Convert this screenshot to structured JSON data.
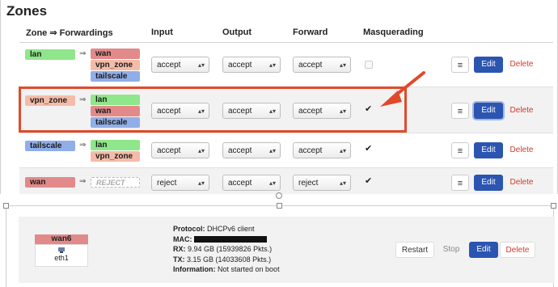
{
  "section_title": "Zones",
  "header": {
    "zone": "Zone ⇒ Forwardings",
    "input": "Input",
    "output": "Output",
    "forward": "Forward",
    "masq": "Masquerading"
  },
  "zones": [
    {
      "name": "lan",
      "targets": [
        "wan",
        "vpn_zone",
        "tailscale"
      ],
      "input": "accept",
      "output": "accept",
      "forward": "accept",
      "masq": false
    },
    {
      "name": "vpn_zone",
      "targets": [
        "lan",
        "wan",
        "tailscale"
      ],
      "input": "accept",
      "output": "accept",
      "forward": "accept",
      "masq": true
    },
    {
      "name": "tailscale",
      "targets": [
        "lan",
        "vpn_zone"
      ],
      "input": "accept",
      "output": "accept",
      "forward": "accept",
      "masq": true
    },
    {
      "name": "wan",
      "targets": [
        "REJECT"
      ],
      "input": "reject",
      "output": "accept",
      "forward": "reject",
      "masq": true
    }
  ],
  "arrow_symbol": "⇒",
  "select_caret": "▴▾",
  "buttons": {
    "menu": "≡",
    "edit": "Edit",
    "delete": "Delete",
    "restart": "Restart",
    "stop": "Stop"
  },
  "checkmark": "✔",
  "colors": {
    "lan": "#90e68a",
    "wan": "#e28a8a",
    "vpn_zone": "#f4bca8",
    "tailscale": "#90aee8",
    "edit": "#2b55b0",
    "delete": "#d23a2d",
    "highlight": "#e04a2b"
  },
  "interface": {
    "name": "wan6",
    "device_icon": "network-adapter-icon",
    "device": "eth1",
    "protocol_label": "Protocol:",
    "protocol": "DHCPv6 client",
    "mac_label": "MAC:",
    "rx_label": "RX:",
    "rx": "9.94 GB (15939826 Pkts.)",
    "tx_label": "TX:",
    "tx": "3.15 GB (14033608 Pkts.)",
    "info_label": "Information:",
    "info": "Not started on boot"
  }
}
